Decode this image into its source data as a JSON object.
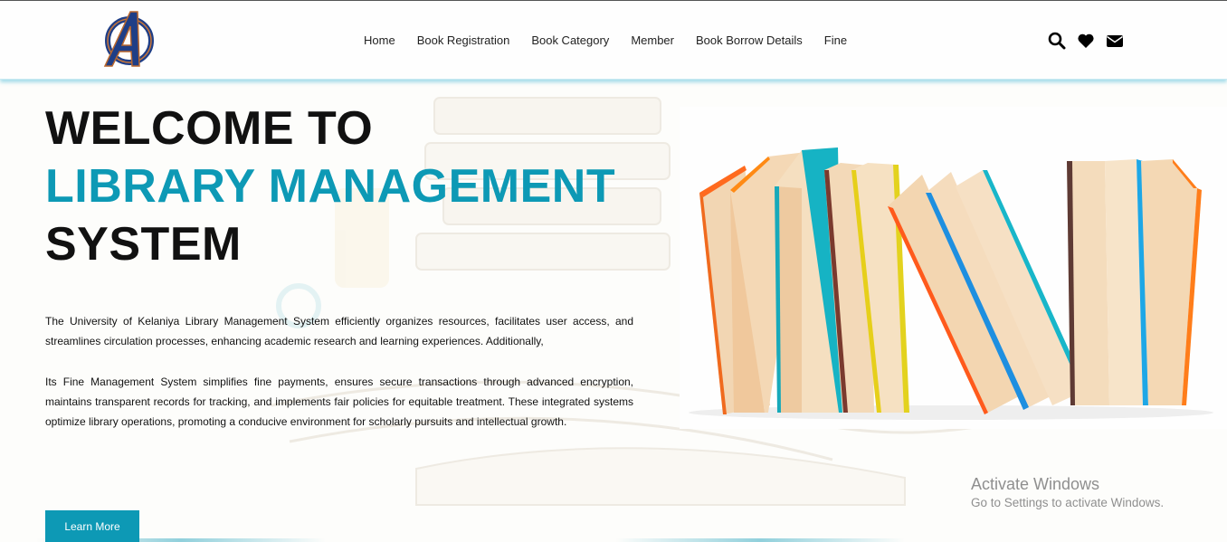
{
  "header": {
    "logo_icon": "avengers-a-logo",
    "nav": [
      "Home",
      "Book Registration",
      "Book Category",
      "Member",
      "Book Borrow Details",
      "Fine"
    ],
    "icons": [
      "search-icon",
      "heart-icon",
      "envelope-icon"
    ]
  },
  "hero": {
    "line1": "WELCOME TO",
    "line2": "LIBRARY MANAGEMENT",
    "line3": "SYSTEM",
    "accent_color": "#0d99b5",
    "paragraph1": "The University of Kelaniya Library Management System efficiently organizes resources, facilitates user access, and streamlines circulation processes, enhancing academic research and learning experiences. Additionally,",
    "paragraph2": "Its Fine Management System simplifies fine payments, ensures secure transactions through advanced encryption, maintains transparent records for tracking, and implements fair policies for equitable treatment. These integrated systems optimize library operations, promoting a conducive environment for scholarly pursuits and intellectual growth.",
    "button": "Learn More"
  },
  "watermark": {
    "title": "Activate Windows",
    "subtitle": "Go to Settings to activate Windows."
  }
}
